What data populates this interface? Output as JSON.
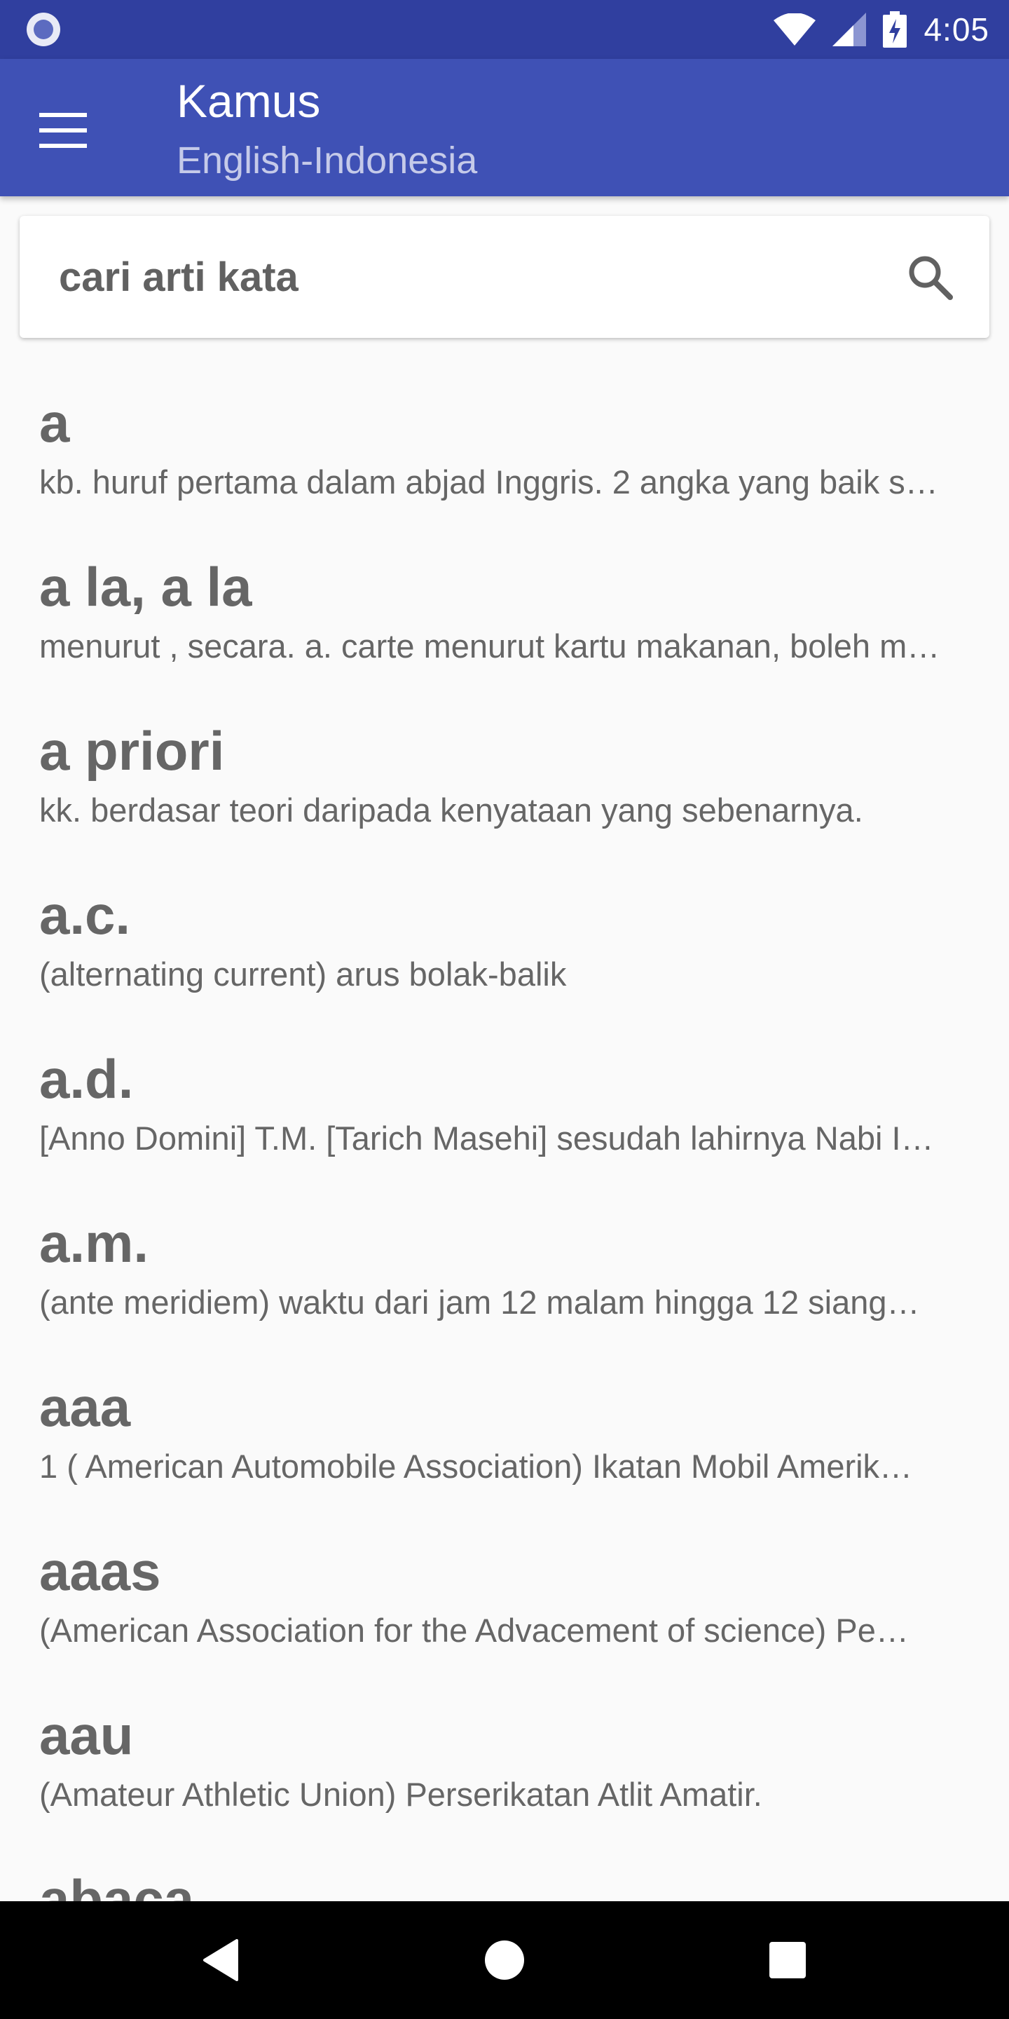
{
  "status_bar": {
    "time": "4:05",
    "icons": [
      "app-notification-icon",
      "wifi-icon",
      "signal-icon",
      "battery-charging-icon"
    ]
  },
  "app_bar": {
    "title": "Kamus",
    "subtitle": "English-Indonesia",
    "menu_icon": "hamburger-menu-icon"
  },
  "search": {
    "placeholder": "cari arti kata",
    "icon": "search-icon"
  },
  "words": [
    {
      "word": "a",
      "definition": "kb. huruf pertama dalam abjad Inggris. 2 angka yang baik s…"
    },
    {
      "word": "a la, a la",
      "definition": "menurut , secara. a. carte menurut kartu makanan, boleh m…"
    },
    {
      "word": "a priori",
      "definition": "kk. berdasar teori daripada kenyataan yang sebenarnya."
    },
    {
      "word": "a.c.",
      "definition": "(alternating current) arus bolak-balik"
    },
    {
      "word": "a.d.",
      "definition": "[Anno Domini] T.M. [Tarich Masehi] sesudah lahirnya Nabi I…"
    },
    {
      "word": "a.m.",
      "definition": "(ante meridiem) waktu dari jam 12 malam hingga 12 siang…"
    },
    {
      "word": "aaa",
      "definition": "1 ( American Automobile Association)  Ikatan Mobil Amerik…"
    },
    {
      "word": "aaas",
      "definition": "(American Association for the  Advacement of science)  Pe…"
    },
    {
      "word": "aau",
      "definition": "(Amateur Athletic Union) Perserikatan Atlit Amatir."
    },
    {
      "word": "abaca",
      "definition": ""
    }
  ],
  "nav_bar": {
    "icons": [
      "back-icon",
      "home-icon",
      "recents-icon"
    ]
  },
  "colors": {
    "status_bar": "#303f9f",
    "app_bar": "#3f51b5",
    "subtitle": "#c5cae9",
    "text": "#666666",
    "background": "#fafafa"
  }
}
